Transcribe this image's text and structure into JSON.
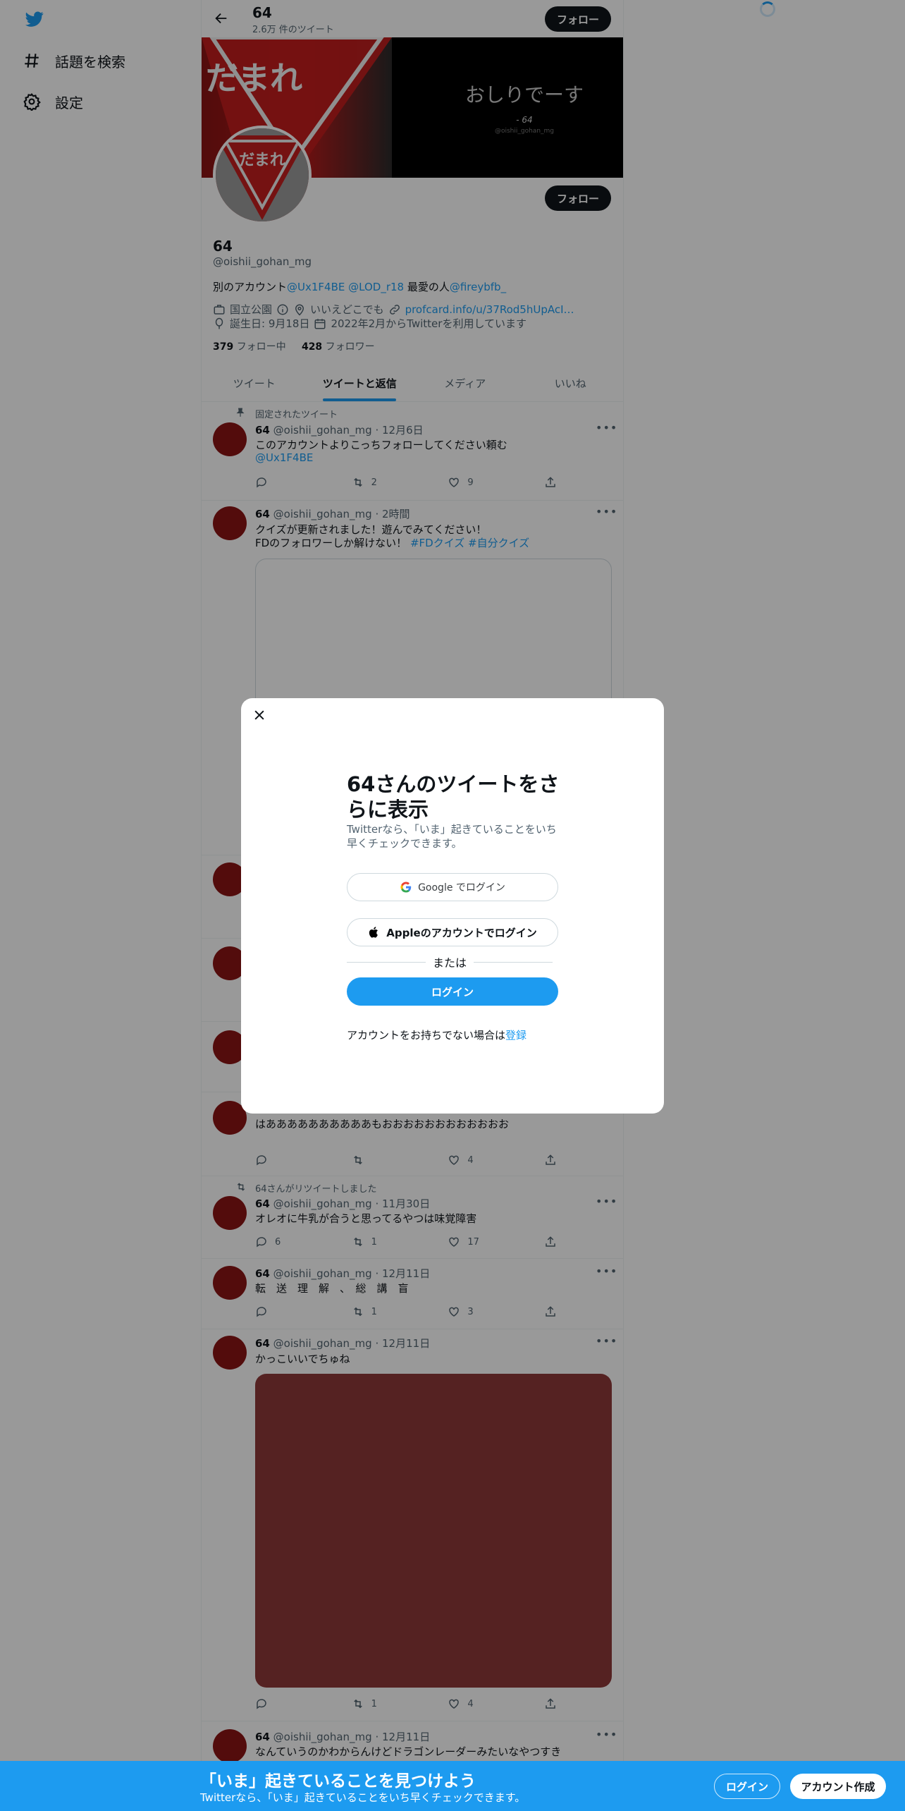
{
  "nav": {
    "items": [
      {
        "label": "話題を検索",
        "icon": "hashtag-icon"
      },
      {
        "label": "設定",
        "icon": "gear-icon"
      }
    ]
  },
  "header": {
    "name": "64",
    "tweet_count": "2.6万 件のツイート",
    "follow_label": "フォロー"
  },
  "banner": {
    "sign_text": "だまれ",
    "main_text": "おしりでーす",
    "sub_text": "- 64",
    "small_text": "@oishii_gohan_mg"
  },
  "profile": {
    "follow_label": "フォロー",
    "name": "64",
    "handle": "@oishii_gohan_mg",
    "bio_prefix": "別のアカウント",
    "bio_link1": "@Ux1F4BE",
    "bio_link2": "@LOD_r18",
    "bio_mid": " 最愛の人",
    "bio_link3": "@fireybfb_",
    "category": "国立公園",
    "location": "いいえどこでも",
    "url": "profcard.info/u/37Rod5hUpAcI…",
    "birthday": "誕生日: 9月18日",
    "joined": "2022年2月からTwitterを利用しています",
    "following_count": "379",
    "following_label": "フォロー中",
    "followers_count": "428",
    "followers_label": "フォロワー"
  },
  "tabs": [
    "ツイート",
    "ツイートと返信",
    "メディア",
    "いいね"
  ],
  "tweets": [
    {
      "name": "64",
      "handle": "@oishii_gohan_mg",
      "time": "12月6日",
      "pinned_label": "固定されたツイート",
      "line1": "このアカウントよりこっちフォローしてください頼む",
      "line2": "@Ux1F4BE",
      "retweets": "2",
      "likes": "9"
    },
    {
      "name": "64",
      "handle": "@oishii_gohan_mg",
      "time": "2時間",
      "line1": "クイズが更新されました！遊んでみてください！",
      "line2_prefix": "FDのフォロワーしか解けない！ ",
      "line2_tags": "#FDクイズ #自分クイズ"
    },
    {
      "line1": "はああああああああああもおおおおおおおおおおおお",
      "likes": "4"
    },
    {
      "name": "64",
      "handle": "@oishii_gohan_mg",
      "time": "11月30日",
      "rt_label": "64さんがリツイートしました",
      "line1": "オレオに牛乳が合うと思ってるやつは味覚障害",
      "replies": "6",
      "retweets": "1",
      "likes": "17"
    },
    {
      "name": "64",
      "handle": "@oishii_gohan_mg",
      "time": "12月11日",
      "line1": "転　送　理　解　、　総　講　盲",
      "retweets": "1",
      "likes": "3"
    },
    {
      "name": "64",
      "handle": "@oishii_gohan_mg",
      "time": "12月11日",
      "line1": "かっこいいでちゅね",
      "retweets": "1",
      "likes": "4"
    },
    {
      "name": "64",
      "handle": "@oishii_gohan_mg",
      "time": "12月11日",
      "line1": "なんていうのかわからんけどドラゴンレーダーみたいなやつすき"
    }
  ],
  "modal": {
    "title": "64さんのツイートをさらに表示",
    "subtitle": "Twitterなら、「いま」起きていることをいち早くチェックできます。",
    "google_label": "Google でログイン",
    "apple_label": "Appleのアカウントでログイン",
    "or_label": "または",
    "login_label": "ログイン",
    "signup_prefix": "アカウントをお持ちでない場合は",
    "signup_link": "登録"
  },
  "bottom": {
    "title": "「いま」起きていることを見つけよう",
    "subtitle": "Twitterなら、「いま」起きていることをいち早くチェックできます。",
    "login_label": "ログイン",
    "signup_label": "アカウント作成"
  },
  "colors": {
    "accent": "#1d9bf0",
    "dark": "#0f1419",
    "muted": "#536471"
  }
}
